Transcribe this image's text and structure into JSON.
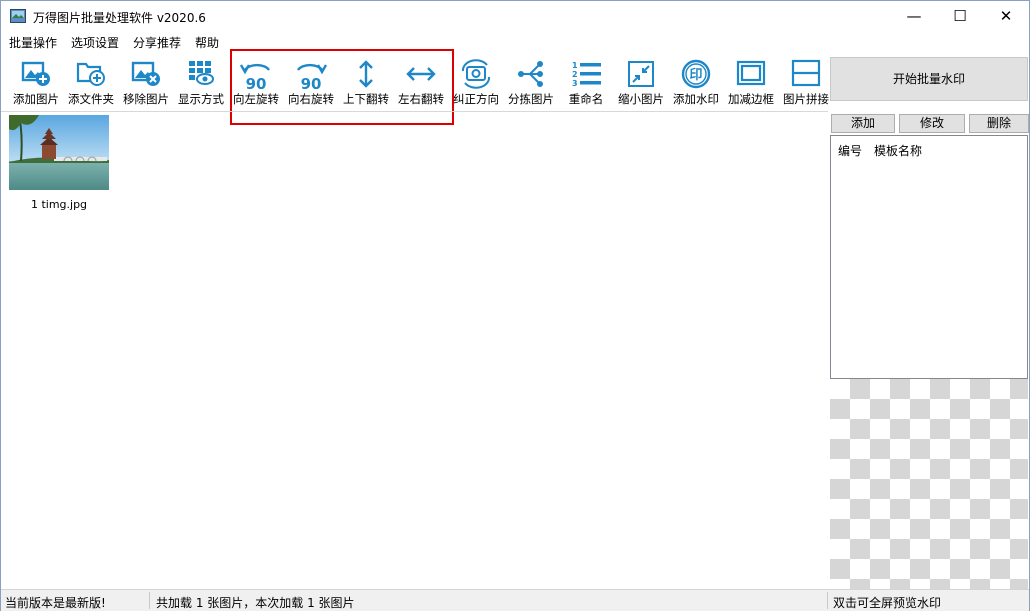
{
  "window": {
    "title": "万得图片批量处理软件 v2020.6",
    "minimize_glyph": "—",
    "maximize_glyph": "☐",
    "close_glyph": "✕"
  },
  "menu": [
    "批量操作",
    "选项设置",
    "分享推荐",
    "帮助"
  ],
  "toolbar": {
    "accent_color": "#1e87c8",
    "items": [
      {
        "label": "添加图片",
        "icon": "add-image-icon"
      },
      {
        "label": "添文件夹",
        "icon": "add-folder-icon"
      },
      {
        "label": "移除图片",
        "icon": "remove-image-icon"
      },
      {
        "label": "显示方式",
        "icon": "display-mode-icon"
      },
      {
        "label": "向左旋转",
        "icon": "rotate-left-icon",
        "glyph_text": "90"
      },
      {
        "label": "向右旋转",
        "icon": "rotate-right-icon",
        "glyph_text": "90"
      },
      {
        "label": "上下翻转",
        "icon": "flip-vertical-icon"
      },
      {
        "label": "左右翻转",
        "icon": "flip-horizontal-icon"
      },
      {
        "label": "纠正方向",
        "icon": "correct-orientation-icon"
      },
      {
        "label": "分拣图片",
        "icon": "sort-images-icon"
      },
      {
        "label": "重命名",
        "icon": "rename-icon"
      },
      {
        "label": "缩小图片",
        "icon": "shrink-image-icon"
      },
      {
        "label": "添加水印",
        "icon": "add-watermark-icon",
        "glyph_text": "印"
      },
      {
        "label": "加减边框",
        "icon": "border-icon"
      },
      {
        "label": "图片拼接",
        "icon": "stitch-icon"
      }
    ]
  },
  "thumbnails": [
    {
      "filename": "1 timg.jpg"
    }
  ],
  "sidebar": {
    "start_button": "开始批量水印",
    "buttons": [
      "添加",
      "修改",
      "删除"
    ],
    "columns": [
      "编号",
      "模板名称"
    ]
  },
  "status": {
    "left": "当前版本是最新版!",
    "middle": "共加载 1 张图片，本次加载 1 张图片",
    "right": "双击可全屏预览水印"
  }
}
